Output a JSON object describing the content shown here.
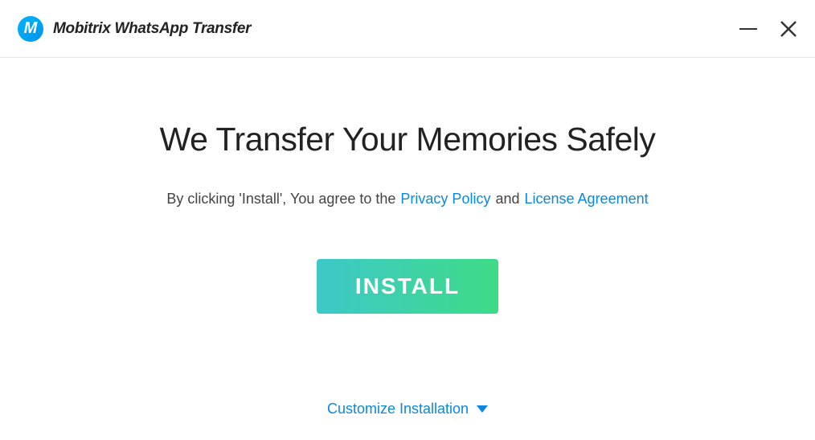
{
  "header": {
    "logo_letter": "M",
    "app_title": "Mobitrix WhatsApp Transfer"
  },
  "main": {
    "headline": "We Transfer Your Memories Safely",
    "consent_prefix": "By clicking 'Install', You agree to the",
    "privacy_link": "Privacy Policy",
    "consent_and": "and",
    "license_link": "License Agreement",
    "install_button": "INSTALL",
    "customize_text": "Customize Installation"
  }
}
